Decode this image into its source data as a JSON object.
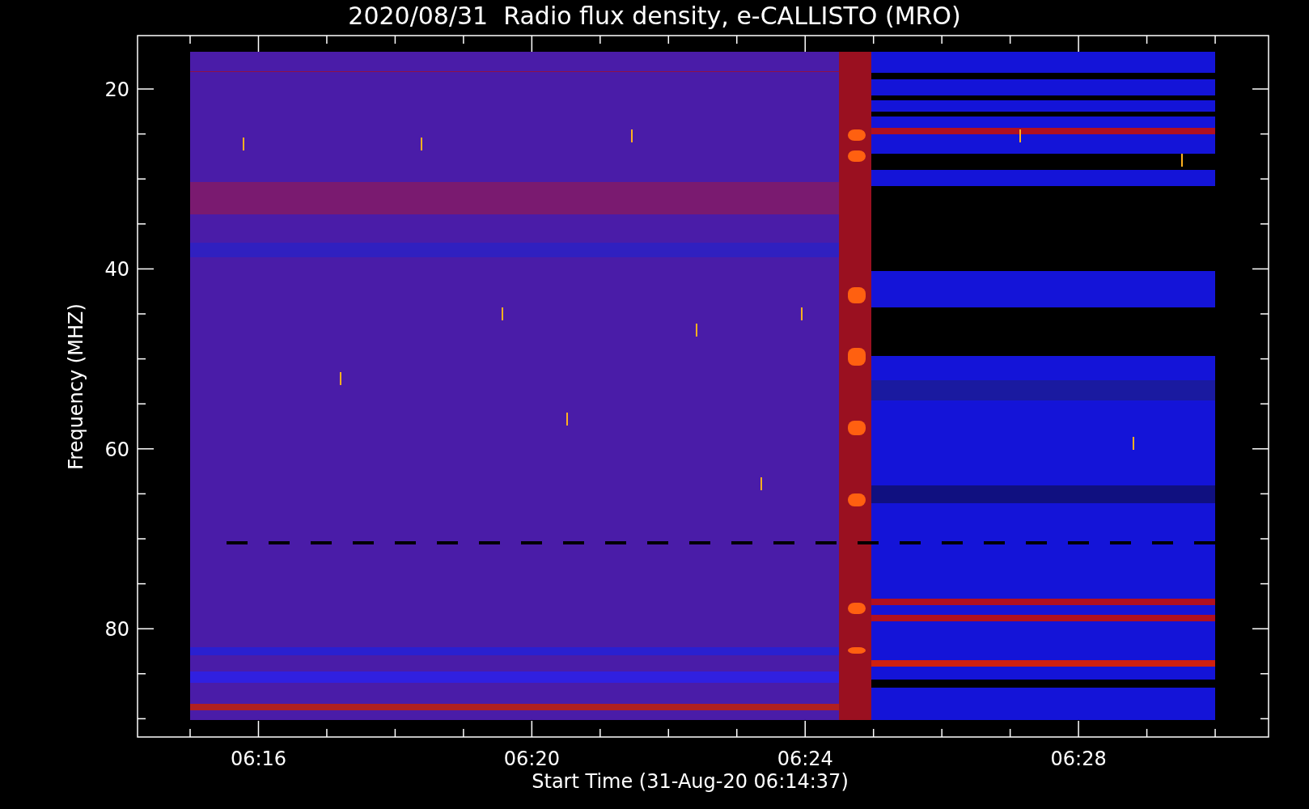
{
  "title": "2020/08/31  Radio flux density, e-CALLISTO (MRO)",
  "y_axis": {
    "label": "Frequency (MHZ)",
    "ticks": [
      "20",
      "40",
      "60",
      "80"
    ]
  },
  "x_axis": {
    "label": "Start Time (31-Aug-20 06:14:37)",
    "ticks": [
      "06:16",
      "06:20",
      "06:24",
      "06:28"
    ]
  }
}
